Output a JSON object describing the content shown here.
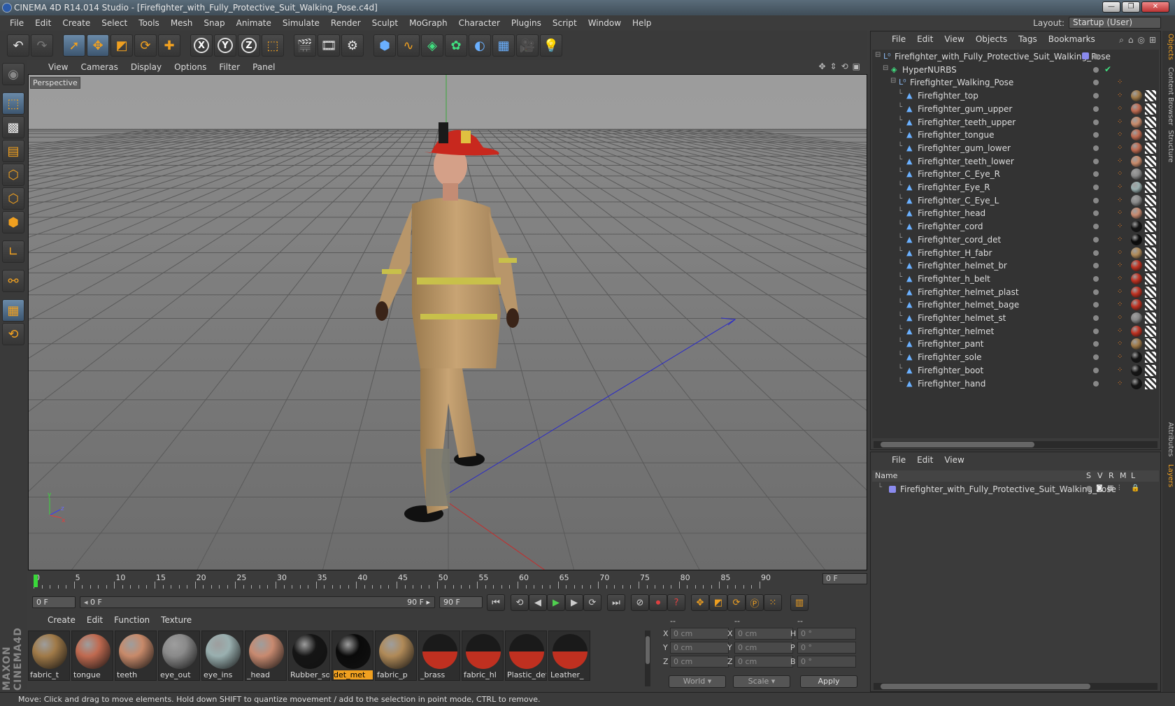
{
  "app": {
    "title": "CINEMA 4D R14.014 Studio - [Firefighter_with_Fully_Protective_Suit_Walking_Pose.c4d]"
  },
  "menubar": [
    "File",
    "Edit",
    "Create",
    "Select",
    "Tools",
    "Mesh",
    "Snap",
    "Animate",
    "Simulate",
    "Render",
    "Sculpt",
    "MoGraph",
    "Character",
    "Plugins",
    "Script",
    "Window",
    "Help"
  ],
  "layout": {
    "label": "Layout:",
    "value": "Startup (User)"
  },
  "viewport": {
    "menu": [
      "View",
      "Cameras",
      "Display",
      "Options",
      "Filter",
      "Panel"
    ],
    "label": "Perspective"
  },
  "timeline": {
    "ticks": [
      "0",
      "5",
      "10",
      "15",
      "20",
      "25",
      "30",
      "35",
      "40",
      "45",
      "50",
      "55",
      "60",
      "65",
      "70",
      "75",
      "80",
      "85",
      "90"
    ],
    "current_frame": "0 F"
  },
  "transport": {
    "start": "0 F",
    "range_start": "0 F",
    "range_end": "90 F",
    "end": "90 F"
  },
  "materials": {
    "menu": [
      "Create",
      "Edit",
      "Function",
      "Texture"
    ],
    "items": [
      {
        "name": "fabric_t",
        "color": "#a07a48"
      },
      {
        "name": "tongue",
        "color": "#c06a50"
      },
      {
        "name": "teeth",
        "color": "#c88a6a"
      },
      {
        "name": "eye_out",
        "color": "#8a8a8a"
      },
      {
        "name": "eye_ins",
        "color": "#9ab0b0"
      },
      {
        "name": "_head",
        "color": "#c88a70"
      },
      {
        "name": "Rubber_so",
        "color": "#151515"
      },
      {
        "name": "det_met",
        "color": "#0a0a0a"
      },
      {
        "name": "fabric_p",
        "color": "#b08a58"
      },
      {
        "name": "_brass",
        "color": "#c03020"
      },
      {
        "name": "fabric_hl",
        "color": "#c03020"
      },
      {
        "name": "Plastic_det",
        "color": "#c03020"
      },
      {
        "name": "Leather_",
        "color": "#c03020"
      }
    ],
    "selected": "det_met"
  },
  "coords": {
    "header": [
      "--",
      "--",
      "--"
    ],
    "rows": [
      {
        "a": "X",
        "av": "0 cm",
        "b": "X",
        "bv": "0 cm",
        "c": "H",
        "cv": "0 °"
      },
      {
        "a": "Y",
        "av": "0 cm",
        "b": "Y",
        "bv": "0 cm",
        "c": "P",
        "cv": "0 °"
      },
      {
        "a": "Z",
        "av": "0 cm",
        "b": "Z",
        "bv": "0 cm",
        "c": "B",
        "cv": "0 °"
      }
    ],
    "world": "World",
    "scale": "Scale",
    "apply": "Apply"
  },
  "objects": {
    "menu": [
      "File",
      "Edit",
      "View",
      "Objects",
      "Tags",
      "Bookmarks"
    ],
    "items": [
      {
        "name": "Firefighter_with_Fully_Protective_Suit_Walking_Pose",
        "level": 0,
        "icon": "null"
      },
      {
        "name": "HyperNURBS",
        "level": 1,
        "icon": "nurbs"
      },
      {
        "name": "Firefighter_Walking_Pose",
        "level": 2,
        "icon": "null"
      },
      {
        "name": "Firefighter_top",
        "level": 3,
        "icon": "poly",
        "mat": "#a07a48"
      },
      {
        "name": "Firefighter_gum_upper",
        "level": 3,
        "icon": "poly",
        "mat": "#c06a50"
      },
      {
        "name": "Firefighter_teeth_upper",
        "level": 3,
        "icon": "poly",
        "mat": "#c88a6a"
      },
      {
        "name": "Firefighter_tongue",
        "level": 3,
        "icon": "poly",
        "mat": "#c06a50"
      },
      {
        "name": "Firefighter_gum_lower",
        "level": 3,
        "icon": "poly",
        "mat": "#c06a50"
      },
      {
        "name": "Firefighter_teeth_lower",
        "level": 3,
        "icon": "poly",
        "mat": "#c88a6a"
      },
      {
        "name": "Firefighter_C_Eye_R",
        "level": 3,
        "icon": "poly",
        "mat": "#8a8a8a"
      },
      {
        "name": "Firefighter_Eye_R",
        "level": 3,
        "icon": "poly",
        "mat": "#9ab0b0"
      },
      {
        "name": "Firefighter_C_Eye_L",
        "level": 3,
        "icon": "poly",
        "mat": "#8a8a8a"
      },
      {
        "name": "Firefighter_head",
        "level": 3,
        "icon": "poly",
        "mat": "#c88a70"
      },
      {
        "name": "Firefighter_cord",
        "level": 3,
        "icon": "poly",
        "mat": "#151515"
      },
      {
        "name": "Firefighter_cord_det",
        "level": 3,
        "icon": "poly",
        "mat": "#0a0a0a"
      },
      {
        "name": "Firefighter_H_fabr",
        "level": 3,
        "icon": "poly",
        "mat": "#b08a58"
      },
      {
        "name": "Firefighter_helmet_br",
        "level": 3,
        "icon": "poly",
        "mat": "#c03020"
      },
      {
        "name": "Firefighter_h_belt",
        "level": 3,
        "icon": "poly",
        "mat": "#c03020"
      },
      {
        "name": "Firefighter_helmet_plast",
        "level": 3,
        "icon": "poly",
        "mat": "#c03020"
      },
      {
        "name": "Firefighter_helmet_bage",
        "level": 3,
        "icon": "poly",
        "mat": "#c03020"
      },
      {
        "name": "Firefighter_helmet_st",
        "level": 3,
        "icon": "poly",
        "mat": "#888888"
      },
      {
        "name": "Firefighter_helmet",
        "level": 3,
        "icon": "poly",
        "mat": "#c03020"
      },
      {
        "name": "Firefighter_pant",
        "level": 3,
        "icon": "poly",
        "mat": "#a07a48"
      },
      {
        "name": "Firefighter_sole",
        "level": 3,
        "icon": "poly",
        "mat": "#151515"
      },
      {
        "name": "Firefighter_boot",
        "level": 3,
        "icon": "poly",
        "mat": "#151515"
      },
      {
        "name": "Firefighter_hand",
        "level": 3,
        "icon": "poly",
        "mat": "#151515"
      }
    ]
  },
  "layers": {
    "menu": [
      "File",
      "Edit",
      "View"
    ],
    "columns": {
      "name": "Name",
      "s": "S",
      "v": "V",
      "r": "R",
      "m": "M",
      "l": "L"
    },
    "row": "Firefighter_with_Fully_Protective_Suit_Walking_Pose"
  },
  "sidetabs": [
    "Objects",
    "Content Browser",
    "Structure",
    "Attributes",
    "Layers"
  ],
  "status": "Move: Click and drag to move elements. Hold down SHIFT to quantize movement / add to the selection in point mode, CTRL to remove."
}
